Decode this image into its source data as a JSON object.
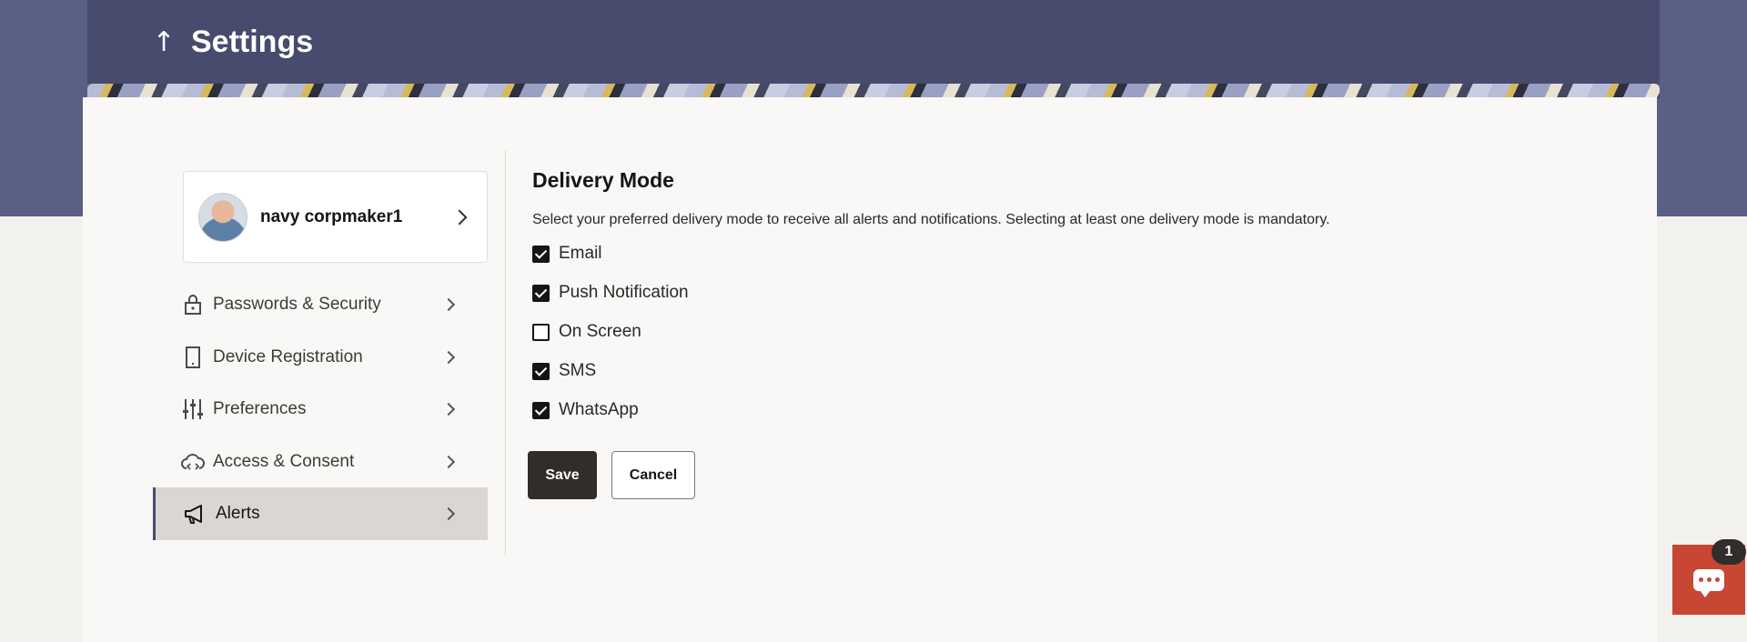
{
  "header": {
    "title": "Settings",
    "back_icon": "arrow-up-icon"
  },
  "profile": {
    "name": "navy corpmaker1"
  },
  "menu": [
    {
      "label": "Passwords & Security",
      "icon": "lock-icon"
    },
    {
      "label": "Device Registration",
      "icon": "device-icon"
    },
    {
      "label": "Preferences",
      "icon": "sliders-icon"
    },
    {
      "label": "Access & Consent",
      "icon": "cloud-code-icon"
    },
    {
      "label": "Alerts",
      "icon": "megaphone-icon",
      "active": true
    }
  ],
  "delivery": {
    "title": "Delivery Mode",
    "description": "Select your preferred delivery mode to receive all alerts and notifications. Selecting at least one delivery mode is mandatory.",
    "options": [
      {
        "label": "Email",
        "checked": true
      },
      {
        "label": "Push Notification",
        "checked": true
      },
      {
        "label": "On Screen",
        "checked": false
      },
      {
        "label": "SMS",
        "checked": true
      },
      {
        "label": "WhatsApp",
        "checked": true
      }
    ]
  },
  "actions": {
    "save": "Save",
    "cancel": "Cancel"
  },
  "chat": {
    "badge": "1"
  },
  "colors": {
    "header": "#474b6d",
    "band": "#5a5f85",
    "primary_button": "#312d2a",
    "chat": "#c74634"
  }
}
